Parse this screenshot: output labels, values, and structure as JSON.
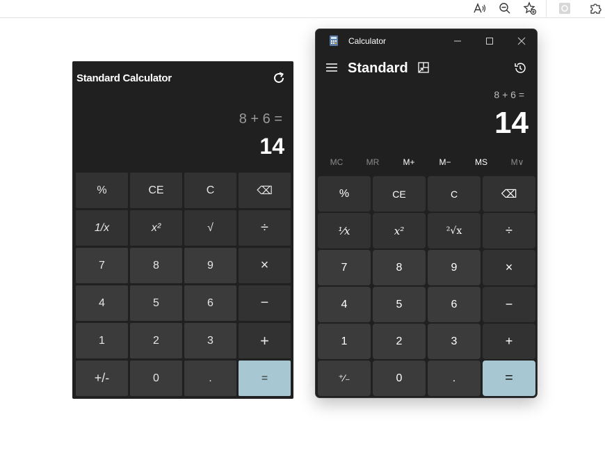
{
  "browser": {
    "icons": [
      "read-aloud-icon",
      "zoom-out-icon",
      "add-favorite-icon",
      "extension-icon",
      "puzzle-icon"
    ]
  },
  "web_calc": {
    "title": "Standard Calculator",
    "expression": "8 + 6 =",
    "result": "14",
    "keys": [
      "%",
      "CE",
      "C",
      "⌫",
      "1/x",
      "x²",
      "√",
      "÷",
      "7",
      "8",
      "9",
      "×",
      "4",
      "5",
      "6",
      "−",
      "1",
      "2",
      "3",
      "+",
      "+/-",
      "0",
      ".",
      "="
    ]
  },
  "win_calc": {
    "app_title": "Calculator",
    "mode": "Standard",
    "expression": "8 + 6 =",
    "result": "14",
    "memory": [
      "MC",
      "MR",
      "M+",
      "M−",
      "MS",
      "M∨"
    ],
    "keys": [
      "%",
      "CE",
      "C",
      "⌫",
      "¹⁄x",
      "x²",
      "²√x",
      "÷",
      "7",
      "8",
      "9",
      "×",
      "4",
      "5",
      "6",
      "−",
      "1",
      "2",
      "3",
      "+",
      "⁺∕₋",
      "0",
      ".",
      "="
    ]
  },
  "colors": {
    "equals": "#a7c8d2",
    "background": "#202020"
  }
}
